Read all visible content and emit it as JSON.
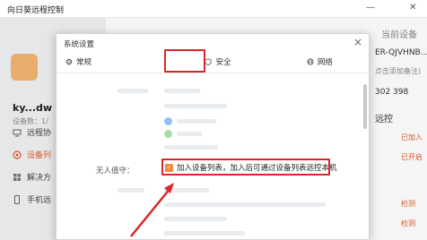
{
  "app": {
    "title": "向日葵远程控制",
    "minimize": "—",
    "close": "✕"
  },
  "sidebar": {
    "device_name": "ky...dw",
    "device_id": "设备数：1/",
    "items": [
      {
        "label": "远程协",
        "icon": "remote-icon"
      },
      {
        "label": "设备列",
        "icon": "device-list-icon"
      },
      {
        "label": "解决方",
        "icon": "solution-icon"
      },
      {
        "label": "手机远",
        "icon": "phone-icon"
      }
    ]
  },
  "right_panel": {
    "heading": "当前设备",
    "code": "ER-QJVHNB...",
    "hint": "点击添加备注)",
    "number": "302 398",
    "remote_label": "远控",
    "links": [
      "已加入",
      "已开启",
      "检测",
      "检测"
    ]
  },
  "dialog": {
    "title": "系统设置",
    "close": "×",
    "tabs": [
      {
        "label": "常规",
        "icon": "gear-icon"
      },
      {
        "label": "安全",
        "icon": "shield-icon"
      },
      {
        "label": "网络",
        "icon": "network-icon"
      }
    ],
    "unattended_label": "无人值守：",
    "checkbox_text": "加入设备列表，加入后可通过设备列表远控本机",
    "checkbox_checked": true,
    "highlight_color": "#d9282b"
  }
}
